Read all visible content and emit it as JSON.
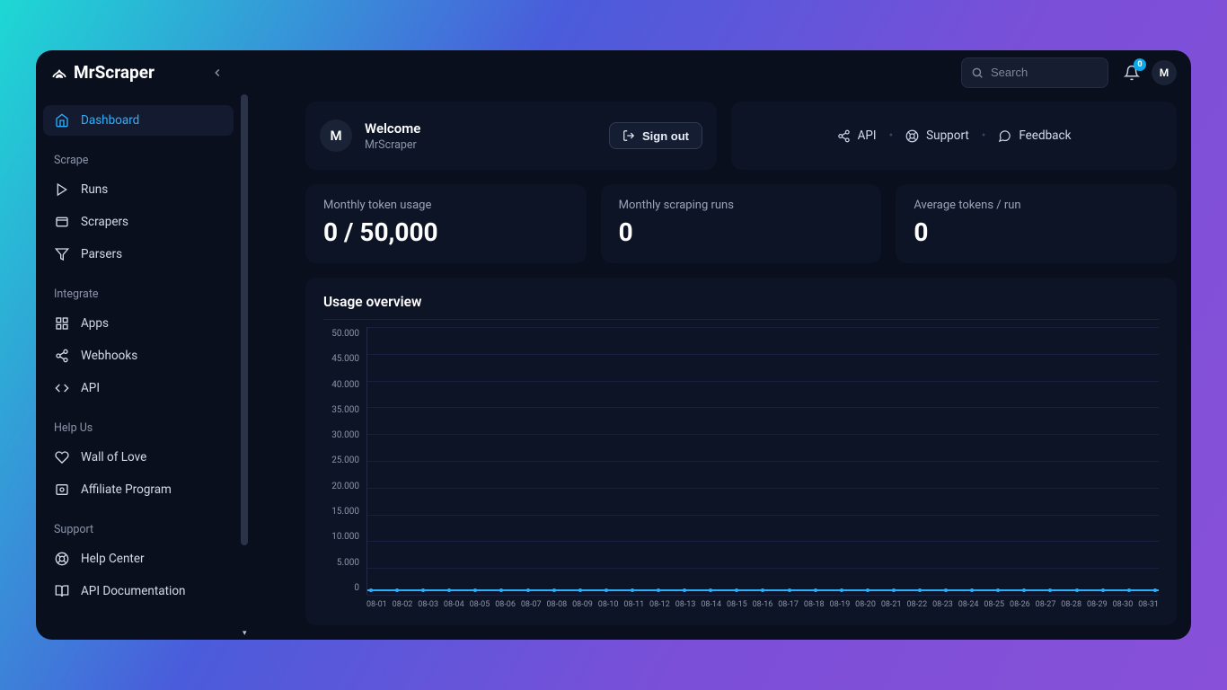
{
  "brand": "MrScraper",
  "header": {
    "search_placeholder": "Search",
    "notification_count": "0",
    "avatar_initial": "M"
  },
  "sidebar": {
    "dashboard": "Dashboard",
    "sections": {
      "scrape": {
        "title": "Scrape",
        "runs": "Runs",
        "scrapers": "Scrapers",
        "parsers": "Parsers"
      },
      "integrate": {
        "title": "Integrate",
        "apps": "Apps",
        "webhooks": "Webhooks",
        "api": "API"
      },
      "helpus": {
        "title": "Help Us",
        "wall": "Wall of Love",
        "affiliate": "Affiliate Program"
      },
      "support": {
        "title": "Support",
        "helpcenter": "Help Center",
        "apidocs": "API Documentation"
      }
    }
  },
  "welcome": {
    "avatar_initial": "M",
    "title": "Welcome",
    "subtitle": "MrScraper",
    "signout": "Sign out"
  },
  "links": {
    "api": "API",
    "support": "Support",
    "feedback": "Feedback"
  },
  "stats": {
    "token_label": "Monthly token usage",
    "token_value": "0 / 50,000",
    "runs_label": "Monthly scraping runs",
    "runs_value": "0",
    "avg_label": "Average tokens / run",
    "avg_value": "0"
  },
  "chart": {
    "title": "Usage overview"
  },
  "chart_data": {
    "type": "line",
    "title": "Usage overview",
    "xlabel": "",
    "ylabel": "",
    "ylim": [
      0,
      50000
    ],
    "yticks": [
      0,
      5000,
      10000,
      15000,
      20000,
      25000,
      30000,
      35000,
      40000,
      45000,
      50000
    ],
    "ytick_labels": [
      "0",
      "5.000",
      "10.000",
      "15.000",
      "20.000",
      "25.000",
      "30.000",
      "35.000",
      "40.000",
      "45.000",
      "50.000"
    ],
    "categories": [
      "08-01",
      "08-02",
      "08-03",
      "08-04",
      "08-05",
      "08-06",
      "08-07",
      "08-08",
      "08-09",
      "08-10",
      "08-11",
      "08-12",
      "08-13",
      "08-14",
      "08-15",
      "08-16",
      "08-17",
      "08-18",
      "08-19",
      "08-20",
      "08-21",
      "08-22",
      "08-23",
      "08-24",
      "08-25",
      "08-26",
      "08-27",
      "08-28",
      "08-29",
      "08-30",
      "08-31"
    ],
    "values": [
      0,
      0,
      0,
      0,
      0,
      0,
      0,
      0,
      0,
      0,
      0,
      0,
      0,
      0,
      0,
      0,
      0,
      0,
      0,
      0,
      0,
      0,
      0,
      0,
      0,
      0,
      0,
      0,
      0,
      0,
      0
    ]
  }
}
